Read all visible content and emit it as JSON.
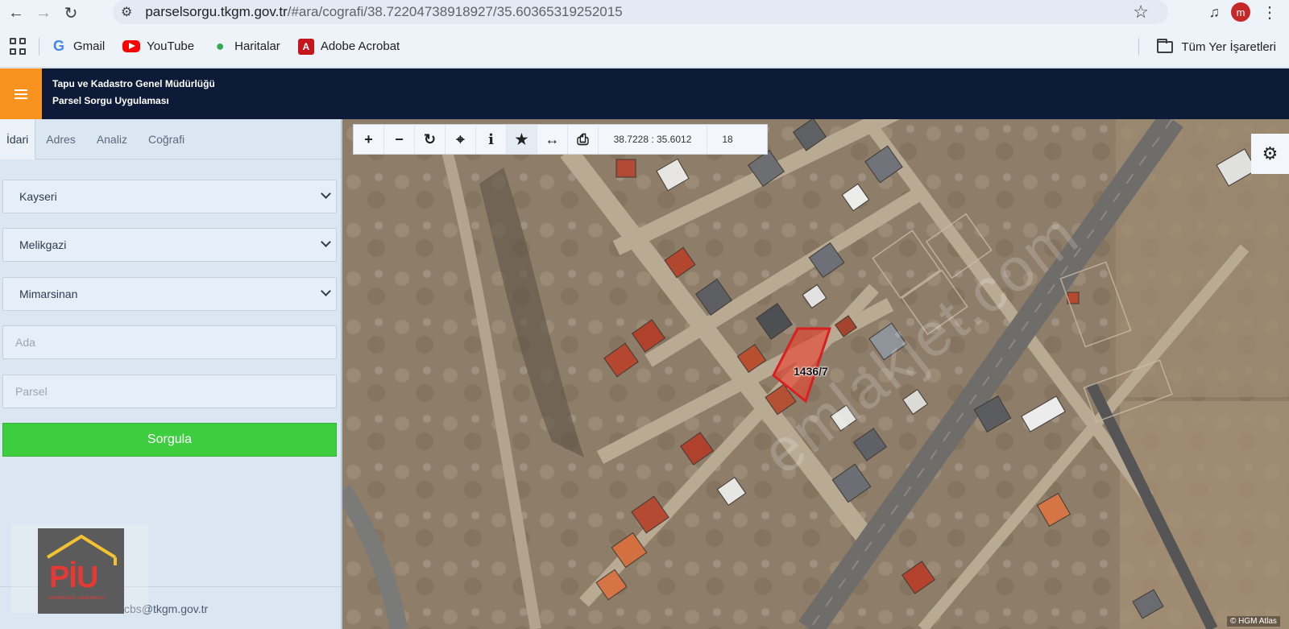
{
  "browser": {
    "url_host": "parselsorgu.tkgm.gov.tr",
    "url_path": "/#ara/cografi/38.72204738918927/35.60365319252015",
    "profile_initial": "m",
    "bookmarks": [
      {
        "label": "Gmail",
        "icon": "gmail-icon"
      },
      {
        "label": "YouTube",
        "icon": "youtube-icon"
      },
      {
        "label": "Haritalar",
        "icon": "maps-icon"
      },
      {
        "label": "Adobe Acrobat",
        "icon": "acrobat-icon"
      }
    ],
    "all_bookmarks_label": "Tüm Yer İşaretleri"
  },
  "app": {
    "title_line1": "Tapu ve Kadastro Genel Müdürlüğü",
    "title_line2": "Parsel Sorgu Uygulaması",
    "accent_color": "#f7931e",
    "header_color": "#0d1b38"
  },
  "panel": {
    "tabs": [
      "İdari",
      "Adres",
      "Analiz",
      "Coğrafi"
    ],
    "active_tab": "İdari",
    "province": "Kayseri",
    "district": "Melikgazi",
    "neighborhood": "Mimarsinan",
    "ada_placeholder": "Ada",
    "parsel_placeholder": "Parsel",
    "submit_label": "Sorgula",
    "submit_color": "#3dcd3f",
    "footer_email": "cbs@tkgm.gov.tr"
  },
  "map": {
    "coordinates": "38.7228 : 35.6012",
    "zoom": "18",
    "parcel_label": "1436/7",
    "attribution": "© HGM Atlas",
    "watermark": "emlakjet.com"
  },
  "logo": {
    "text": "PİU",
    "subtext": "GAYRİMENKUL DANIŞMANLIK"
  }
}
